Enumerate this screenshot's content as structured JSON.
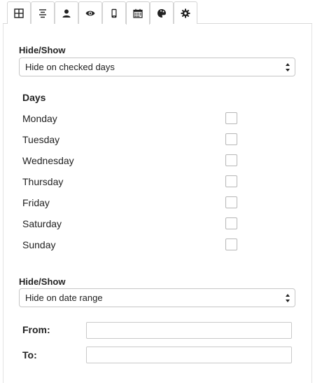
{
  "tabs": [
    {
      "icon": "grid-icon",
      "active": false
    },
    {
      "icon": "align-center-icon",
      "active": false
    },
    {
      "icon": "user-icon",
      "active": false
    },
    {
      "icon": "eye-icon",
      "active": false
    },
    {
      "icon": "mobile-phone-icon",
      "active": false
    },
    {
      "icon": "calendar-icon",
      "active": true
    },
    {
      "icon": "palette-icon",
      "active": false
    },
    {
      "icon": "gear-icon",
      "active": false
    }
  ],
  "days_section": {
    "hide_show_label": "Hide/Show",
    "select_value": "Hide on checked days",
    "title": "Days",
    "days": [
      {
        "label": "Monday",
        "checked": false
      },
      {
        "label": "Tuesday",
        "checked": false
      },
      {
        "label": "Wednesday",
        "checked": false
      },
      {
        "label": "Thursday",
        "checked": false
      },
      {
        "label": "Friday",
        "checked": false
      },
      {
        "label": "Saturday",
        "checked": false
      },
      {
        "label": "Sunday",
        "checked": false
      }
    ]
  },
  "date_section": {
    "hide_show_label": "Hide/Show",
    "select_value": "Hide on date range",
    "from_label": "From:",
    "from_value": "",
    "to_label": "To:",
    "to_value": ""
  }
}
